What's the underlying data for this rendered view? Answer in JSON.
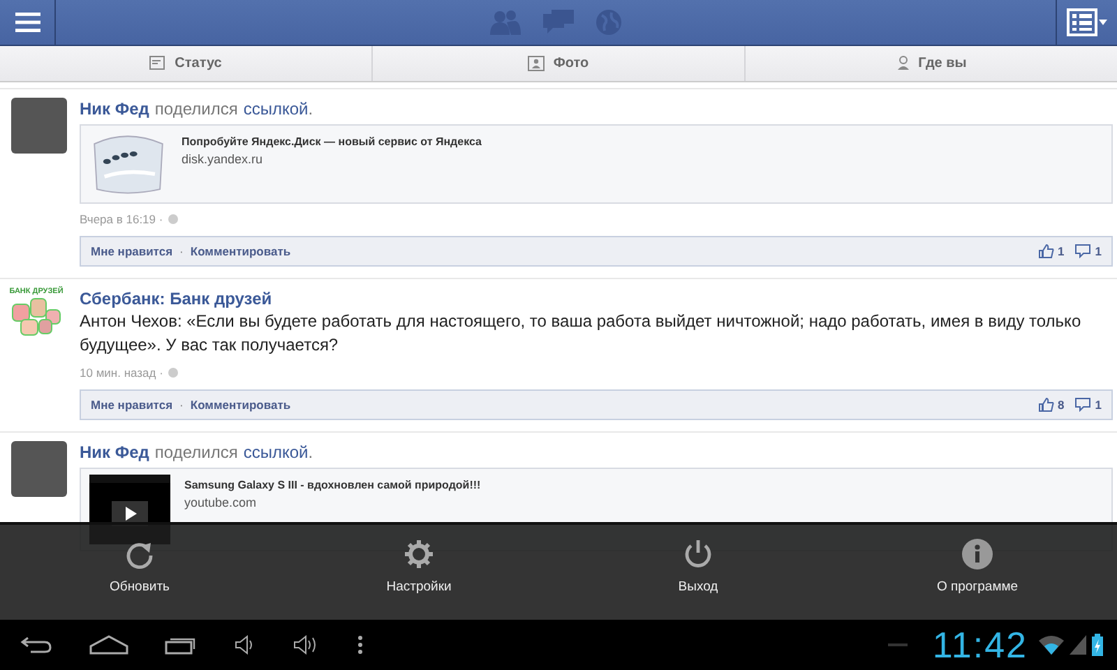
{
  "tabs": [
    {
      "label": "Статус",
      "kind": "status"
    },
    {
      "label": "Фото",
      "kind": "photo"
    },
    {
      "label": "Где вы",
      "kind": "place"
    }
  ],
  "action_separator": "·",
  "posts": [
    {
      "kind": "link",
      "author": "Ник Фед",
      "action": "поделился",
      "link_word": "ссылкой",
      "end": ".",
      "link": {
        "title": "Попробуйте Яндекс.Диск — новый сервис от Яндекса",
        "domain": "disk.yandex.ru",
        "kind": "disk"
      },
      "time": "Вчера в 16:19 ·",
      "actions": [
        "Мне нравится",
        "Комментировать"
      ],
      "likes": "1",
      "comments": "1"
    },
    {
      "kind": "status",
      "author": "Сбербанк: Банк друзей",
      "avatar_label": "БАНК ДРУЗЕЙ",
      "text": "Антон Чехов: «Если вы будете работать для настоящего, то ваша работа выйдет ничтожной; надо работать, имея в виду только будущее». У вас так получается?",
      "time": "10 мин. назад ·",
      "actions": [
        "Мне нравится",
        "Комментировать"
      ],
      "likes": "8",
      "comments": "1"
    },
    {
      "kind": "link",
      "author": "Ник Фед",
      "action": "поделился",
      "link_word": "ссылкой",
      "end": ".",
      "link": {
        "title": "Samsung Galaxy S III - вдохновлен самой природой!!!",
        "domain": "youtube.com",
        "kind": "video"
      }
    }
  ],
  "menu": [
    {
      "label": "Обновить",
      "kind": "refresh"
    },
    {
      "label": "Настройки",
      "kind": "settings"
    },
    {
      "label": "Выход",
      "kind": "power"
    },
    {
      "label": "О программе",
      "kind": "info"
    }
  ],
  "status_bar": {
    "time": "11:42"
  }
}
